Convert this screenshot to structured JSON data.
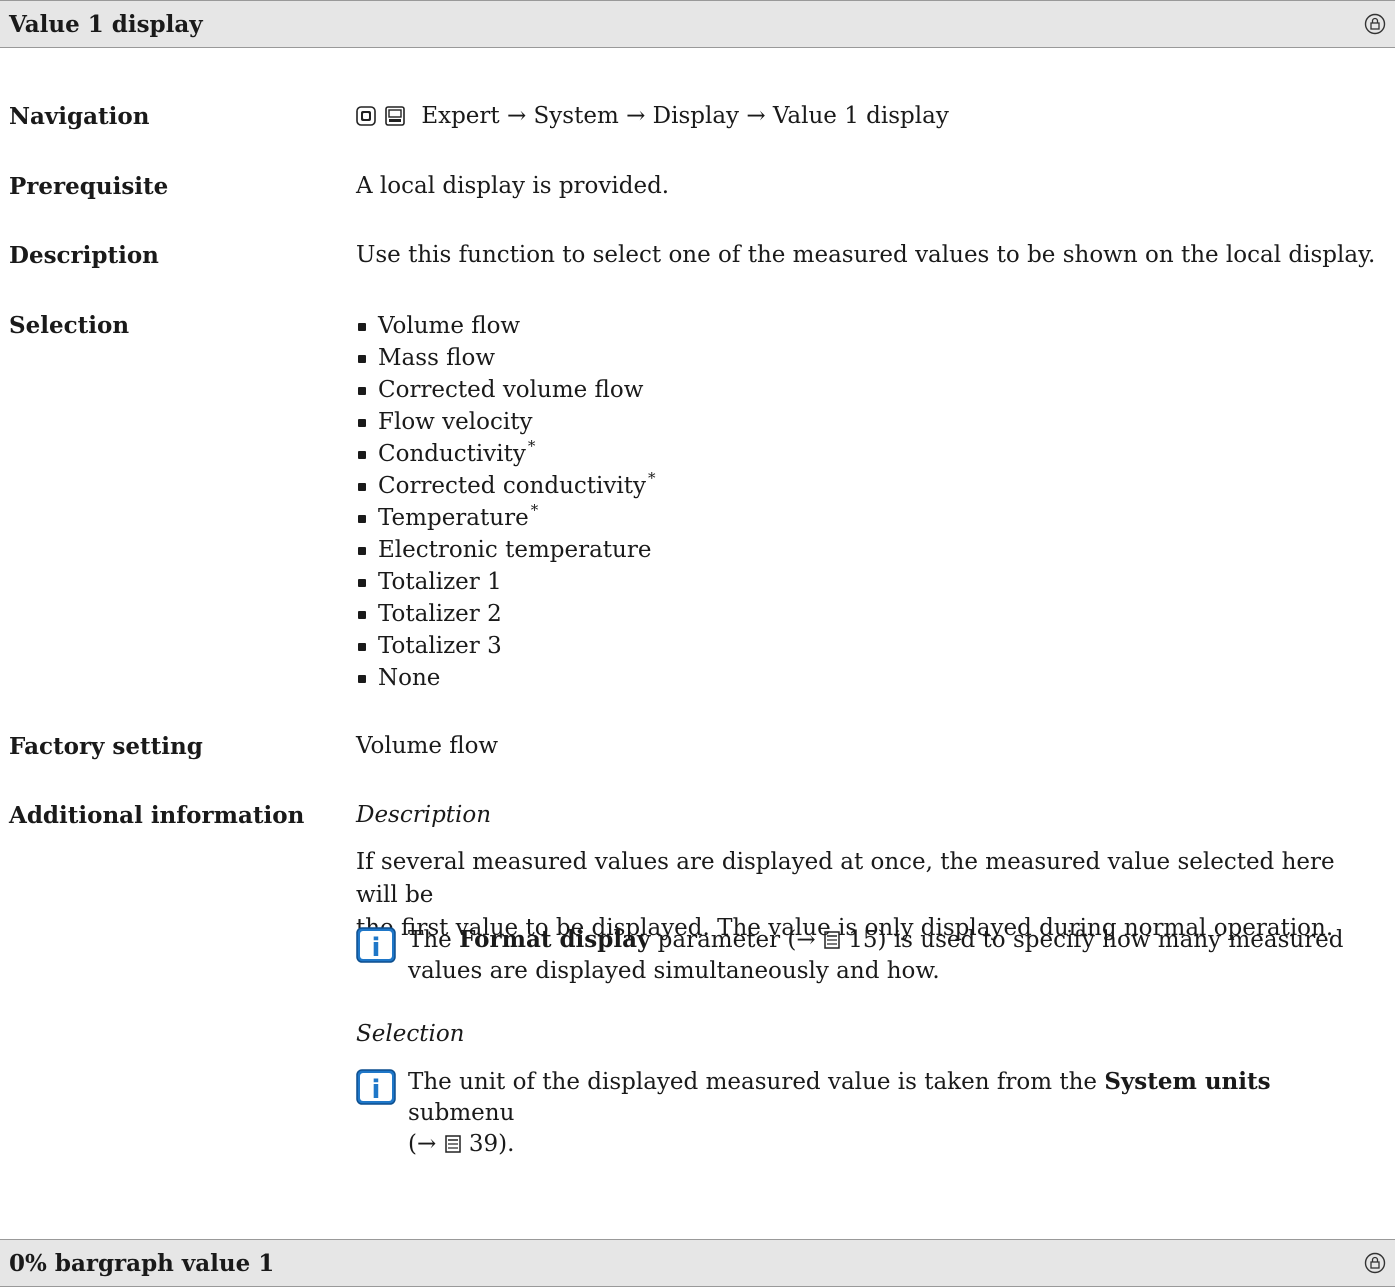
{
  "section1": {
    "title": "Value 1 display",
    "rows": {
      "navigation": {
        "label": "Navigation",
        "path": "Expert → System → Display → Value 1 display"
      },
      "prerequisite": {
        "label": "Prerequisite",
        "value": "A local display is provided."
      },
      "description": {
        "label": "Description",
        "value": "Use this function to select one of the measured values to be shown on the local display."
      },
      "selection": {
        "label": "Selection",
        "items": [
          {
            "text": "Volume flow",
            "mark": ""
          },
          {
            "text": "Mass flow",
            "mark": ""
          },
          {
            "text": "Corrected volume flow",
            "mark": ""
          },
          {
            "text": "Flow velocity",
            "mark": ""
          },
          {
            "text": "Conductivity",
            "mark": "*"
          },
          {
            "text": "Corrected conductivity",
            "mark": "*"
          },
          {
            "text": "Temperature",
            "mark": "*"
          },
          {
            "text": "Electronic temperature",
            "mark": ""
          },
          {
            "text": "Totalizer 1",
            "mark": ""
          },
          {
            "text": "Totalizer 2",
            "mark": ""
          },
          {
            "text": "Totalizer 3",
            "mark": ""
          },
          {
            "text": "None",
            "mark": ""
          }
        ]
      },
      "factory": {
        "label": "Factory setting",
        "value": "Volume flow"
      },
      "additional": {
        "label": "Additional information",
        "desc_heading": "Description",
        "desc_line1": "If several measured values are displayed at once, the measured value selected here will be",
        "desc_line2": "the first value to be displayed. The value is only displayed during normal operation.",
        "note1": {
          "pre": "The ",
          "bold": "Format display",
          "mid": " parameter (→ ",
          "page": "15",
          "post": ") is used to specify how many measured",
          "line2": "values are displayed simultaneously and how."
        },
        "sel_heading": "Selection",
        "note2": {
          "pre": "The unit of the displayed measured value is taken from the ",
          "bold": "System units",
          "post": " submenu",
          "line2_pre": "(→ ",
          "page": "39",
          "line2_post": ")."
        }
      }
    }
  },
  "section2": {
    "title": "0% bargraph value 1"
  }
}
